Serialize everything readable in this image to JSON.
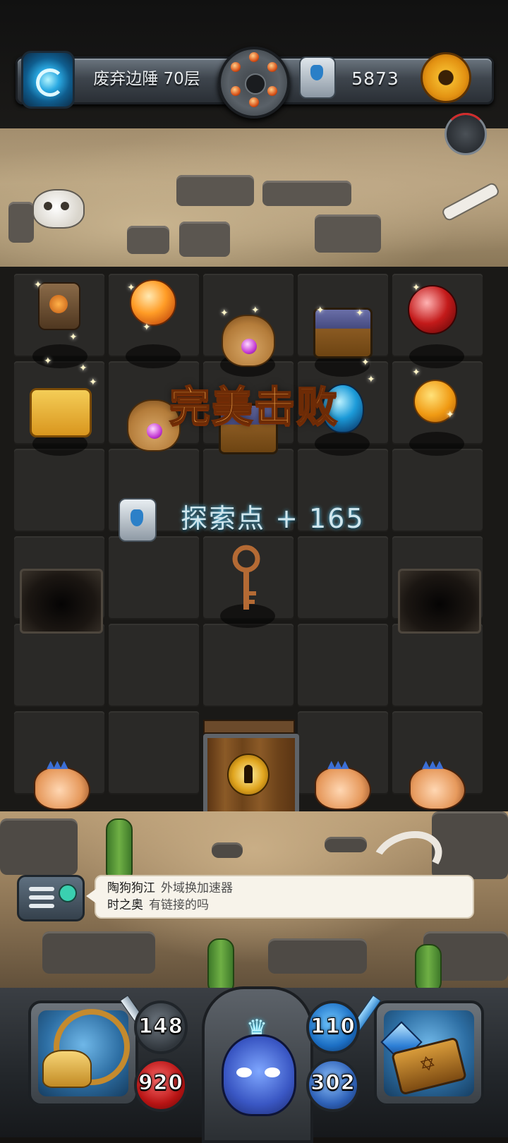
{
  "header": {
    "level_label": "废弃边陲 70层",
    "exploration_points": "5873"
  },
  "icons": {
    "portal": "portal-icon",
    "revolver": "revolver-cylinder-icon",
    "stone": "exploration-stone-icon",
    "settings": "gear-icon",
    "dial": "timer-dial-icon"
  },
  "board": {
    "result_title": "完美击败",
    "reward_text": "探索点 + 165",
    "items": [
      "rune-block",
      "dragon-ball-orb",
      "potion-bag",
      "treasure-chest",
      "red-potion",
      "puzzle-piece",
      "potion-bag",
      "treasure-chest",
      "blue-egg",
      "golden-fruit",
      "bronze-key",
      "dragon-skull",
      "dragon-skull",
      "dragon-skull",
      "locked-door"
    ]
  },
  "chat": {
    "lines": [
      {
        "name": "陶狗狗江",
        "message": "外域换加速器"
      },
      {
        "name": "时之奥",
        "message": "有链接的吗"
      }
    ]
  },
  "hud": {
    "attack": "148",
    "hp": "920",
    "magic": "110",
    "defense": "302"
  },
  "colors": {
    "title_orange": "#f5a84a",
    "reward_cyan": "#cfe6ee",
    "tile_bg": "#2a2927",
    "gear_gold": "#f2b52a"
  }
}
